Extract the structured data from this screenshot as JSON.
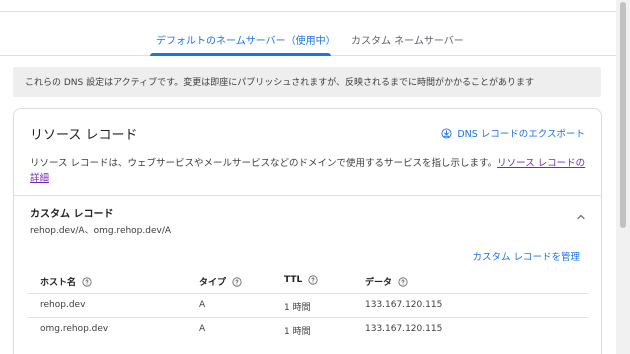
{
  "tabs": {
    "default_label": "デフォルトのネームサーバー（使用中）",
    "custom_label": "カスタム ネームサーバー"
  },
  "notice": "これらの DNS 設定はアクティブです。変更は即座にパブリッシュされますが、反映されるまでに時間がかかることがあります",
  "card": {
    "title": "リソース レコード",
    "export_label": "DNS レコードのエクスポート",
    "description": "リソース レコードは、ウェブサービスやメールサービスなどのドメインで使用するサービスを指し示します。",
    "description_link": "リソース レコードの詳細"
  },
  "custom_records": {
    "title": "カスタム レコード",
    "subtitle": "rehop.dev/A、omg.rehop.dev/A",
    "manage_label": "カスタム レコードを管理"
  },
  "table": {
    "headers": [
      "ホスト名",
      "タイプ",
      "TTL",
      "データ"
    ],
    "rows": [
      [
        "rehop.dev",
        "A",
        "1 時間",
        "133.167.120.115"
      ],
      [
        "omg.rehop.dev",
        "A",
        "1 時間",
        "133.167.120.115"
      ]
    ]
  },
  "colors": {
    "accent": "#1a73e8",
    "visited_link": "#7627bb",
    "notice_bg": "#eeeeee"
  }
}
